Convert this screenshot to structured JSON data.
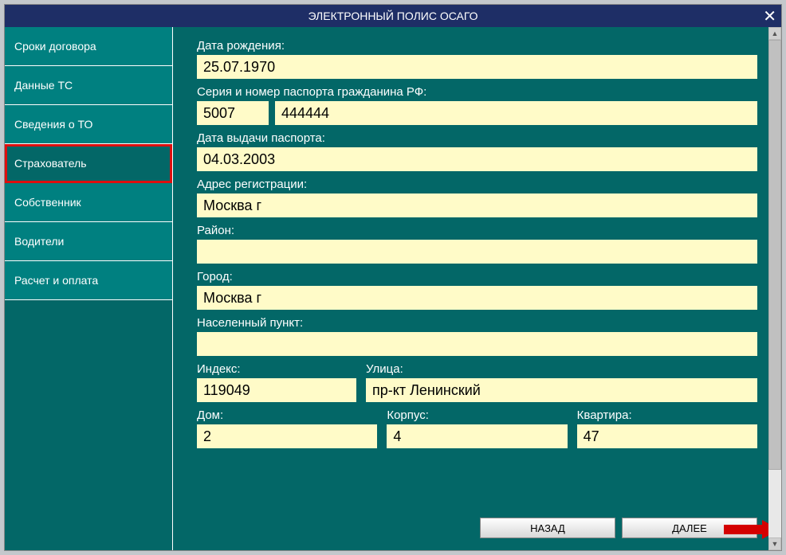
{
  "titlebar": {
    "title": "ЭЛЕКТРОННЫЙ ПОЛИС ОСАГО"
  },
  "sidebar": {
    "items": [
      {
        "label": "Сроки договора"
      },
      {
        "label": "Данные ТС"
      },
      {
        "label": "Сведения о ТО"
      },
      {
        "label": "Страхователь"
      },
      {
        "label": "Собственник"
      },
      {
        "label": "Водители"
      },
      {
        "label": "Расчет и оплата"
      }
    ]
  },
  "form": {
    "birth_label": "Дата рождения:",
    "birth_value": "25.07.1970",
    "passport_label": "Серия и  номер паспорта гражданина РФ:",
    "passport_series": "5007",
    "passport_number": "444444",
    "passport_date_label": "Дата выдачи паспорта:",
    "passport_date": "04.03.2003",
    "reg_label": "Адрес регистрации:",
    "reg_value": "Москва г",
    "district_label": "Район:",
    "district_value": "",
    "city_label": "Город:",
    "city_value": "Москва г",
    "locality_label": "Населенный пункт:",
    "locality_value": "",
    "index_label": "Индекс:",
    "index_value": "119049",
    "street_label": "Улица:",
    "street_value": "пр-кт Ленинский",
    "house_label": "Дом:",
    "house_value": "2",
    "building_label": "Корпус:",
    "building_value": "4",
    "apt_label": "Квартира:",
    "apt_value": "47"
  },
  "buttons": {
    "back": "НАЗАД",
    "next": "ДАЛЕЕ"
  }
}
